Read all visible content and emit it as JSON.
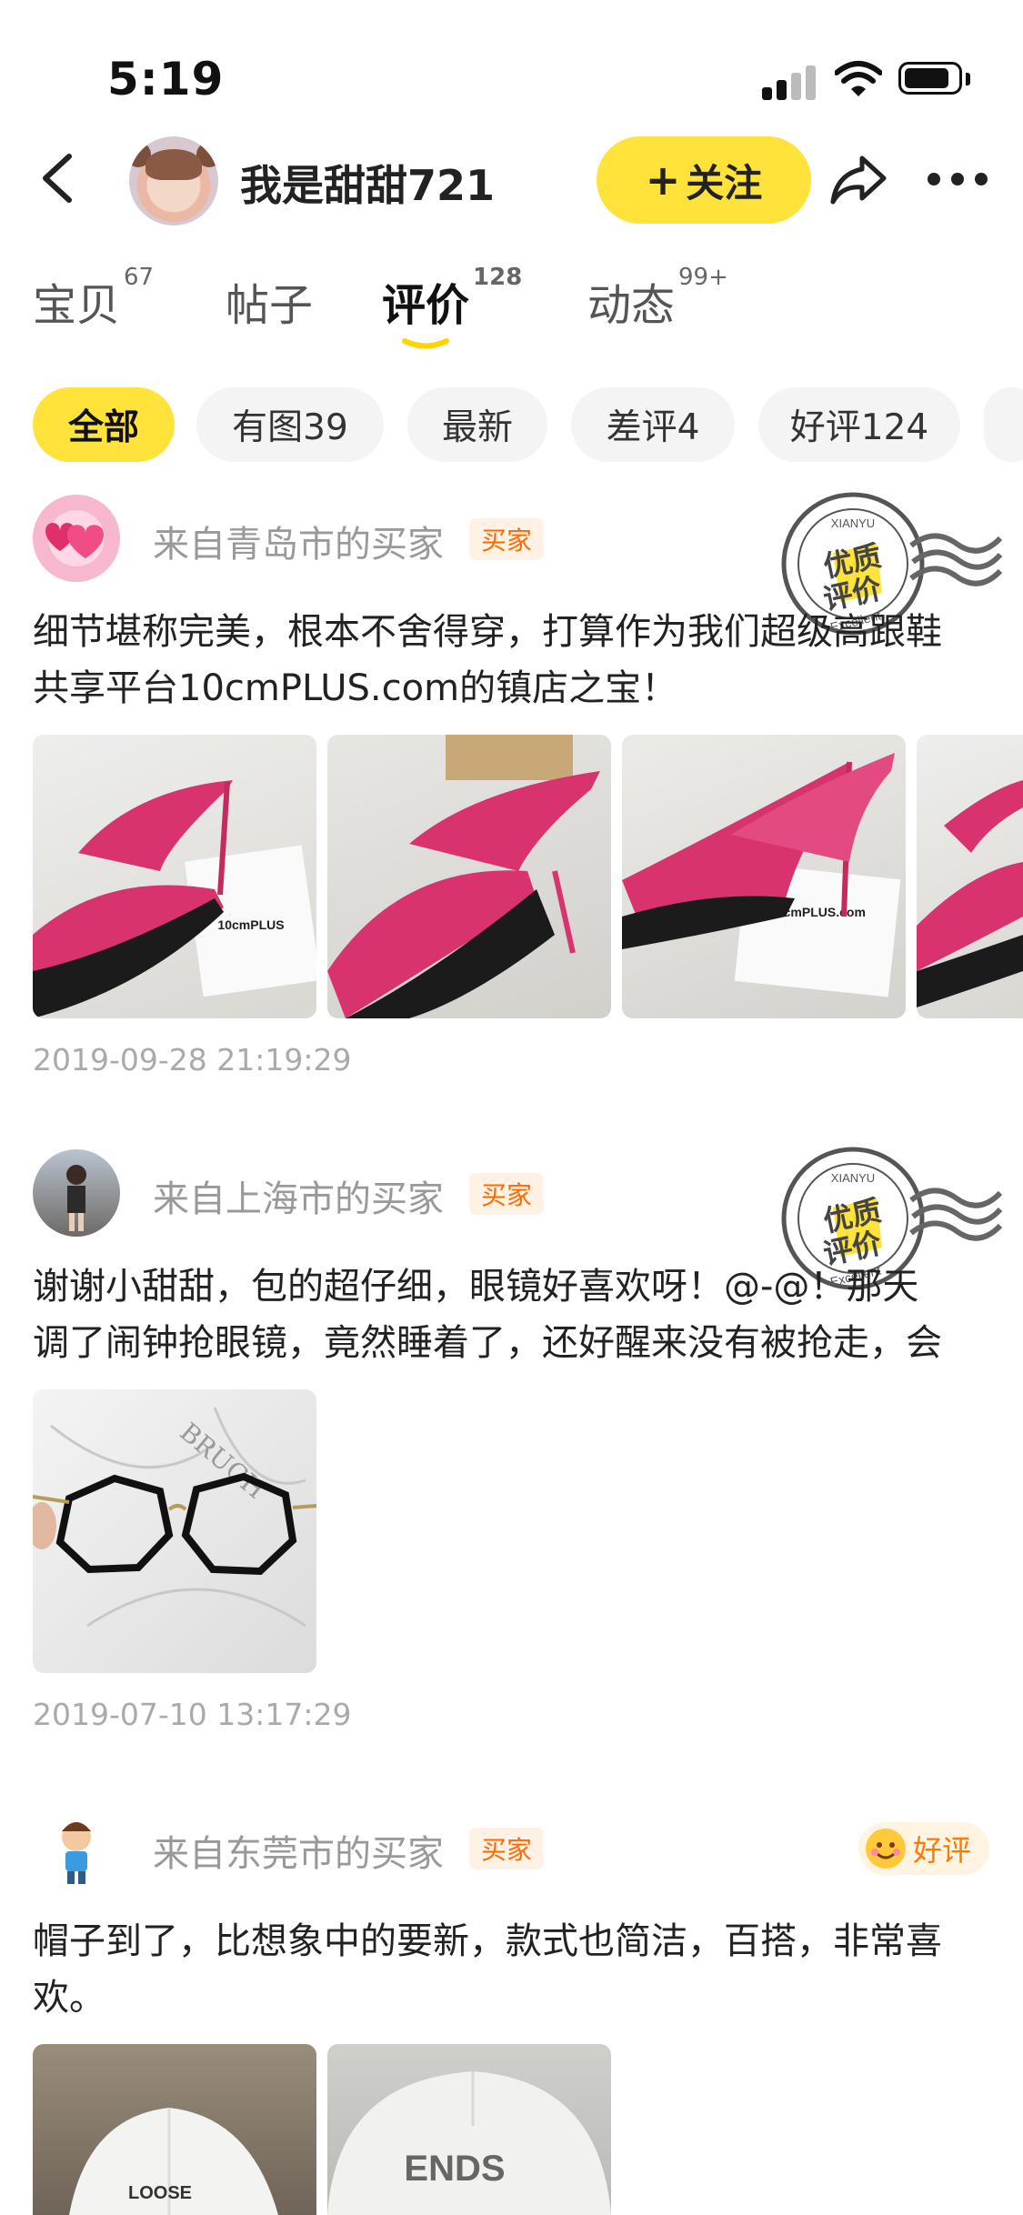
{
  "status_bar": {
    "time": "5:19"
  },
  "header": {
    "username": "我是甜甜721",
    "follow_label": "关注",
    "follow_icon": "+"
  },
  "tabs": [
    {
      "label": "宝贝",
      "count": "67"
    },
    {
      "label": "帖子",
      "count": ""
    },
    {
      "label": "评价",
      "count": "128"
    },
    {
      "label": "动态",
      "count": "99+"
    }
  ],
  "filters": [
    "全部",
    "有图39",
    "最新",
    "差评4",
    "好评124"
  ],
  "stamp": {
    "top": "XIANYU",
    "middle1": "优质",
    "middle2": "评价",
    "bottom": "Excellent"
  },
  "reviews": [
    {
      "from": "来自青岛市的买家",
      "badge": "买家",
      "text_line1": "细节堪称完美，根本不舍得穿，打算作为我们超级高跟鞋",
      "text_line2": "共享平台10cmPLUS.com的镇店之宝！",
      "photo_captions": [
        "10cmPLUS",
        "10cmPLUS.com"
      ],
      "date": "2019-09-28 21:19:29"
    },
    {
      "from": "来自上海市的买家",
      "badge": "买家",
      "text_line1": "谢谢小甜甜，包的超仔细，眼镜好喜欢呀！@-@！那天",
      "text_line2": "调了闹钟抢眼镜，竟然睡着了，还好醒来没有被抢走，会",
      "photo_captions": [
        "BRUCH"
      ],
      "date": "2019-07-10 13:17:29"
    },
    {
      "from": "来自东莞市的买家",
      "badge": "买家",
      "rating": "好评",
      "text_line1": "帽子到了，比想象中的要新，款式也简洁，百搭，非常喜",
      "text_line2": "欢。",
      "photo_captions": [
        "LOOSE",
        "ENDS"
      ]
    }
  ],
  "colors": {
    "accent_yellow": "#ffe33a",
    "badge_orange": "#ff6a00",
    "shoe_pink": "#d8336f"
  }
}
